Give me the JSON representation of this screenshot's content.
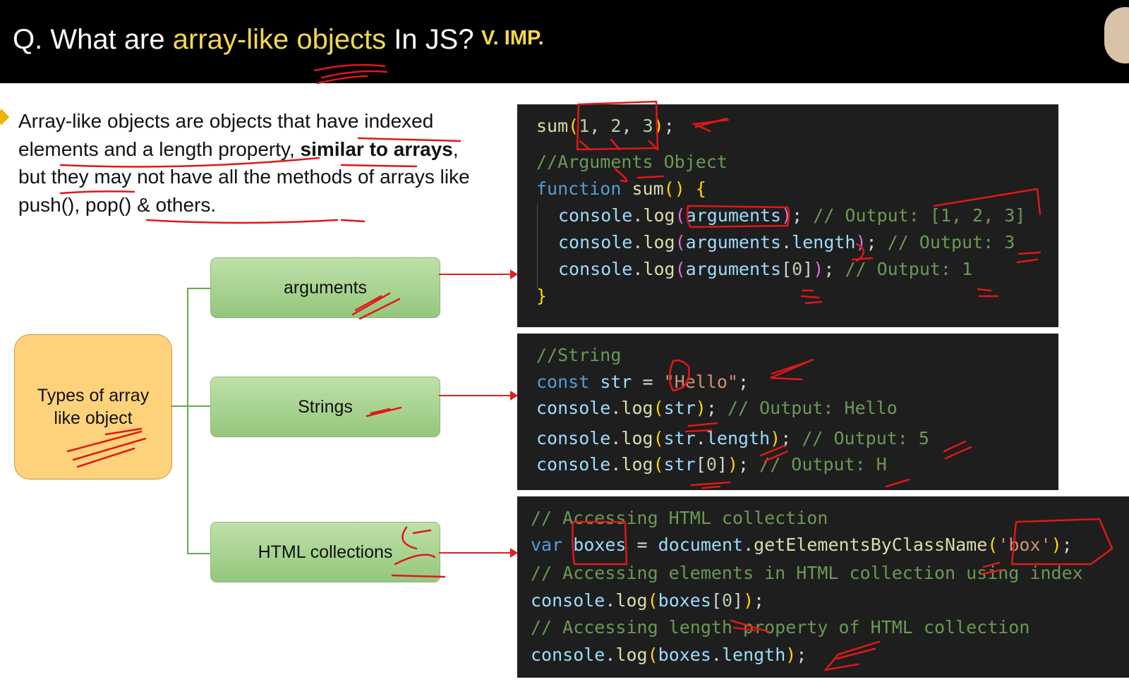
{
  "header": {
    "title_prefix": "Q. What are ",
    "title_highlight": "array-like objects",
    "title_suffix": " In JS?",
    "badge": "V. IMP."
  },
  "intro": {
    "part1": "Array-like objects are objects that have indexed elements and a length property, ",
    "bold1": "similar to arrays",
    "part2": ", but they may not have all the methods of arrays like push(), pop() & others."
  },
  "diagram": {
    "root_label": "Types of array like object",
    "branches": [
      "arguments",
      "Strings",
      "HTML collections"
    ]
  },
  "code_arguments": {
    "lines": [
      "sum(1, 2, 3);",
      "//Arguments Object",
      "function sum() {",
      "console.log(arguments); // Output: [1, 2, 3]",
      "console.log(arguments.length); // Output: 3",
      "console.log(arguments[0]); // Output: 1",
      "}"
    ]
  },
  "code_string": {
    "lines": [
      "//String",
      "const str = \"Hello\";",
      "console.log(str); // Output: Hello",
      "console.log(str.length); // Output: 5",
      "console.log(str[0]); // Output: H"
    ]
  },
  "code_html": {
    "lines": [
      "// Accessing HTML collection",
      "var boxes = document.getElementsByClassName('box');",
      "// Accessing elements in HTML collection using index",
      "console.log(boxes[0]);",
      "// Accessing length property of HTML collection",
      "console.log(boxes.length);"
    ]
  },
  "colors": {
    "header_bg": "#000000",
    "highlight": "#f5d94b",
    "root_fill": "#fdd27b",
    "branch_fill": "#a9d48f",
    "code_bg": "#1e1e1e",
    "annotation": "#e01818"
  }
}
